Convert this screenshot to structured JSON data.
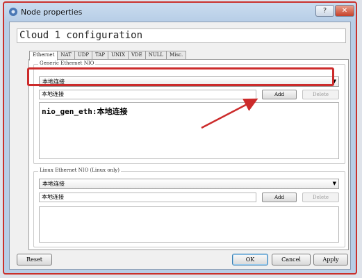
{
  "window": {
    "title": "Node properties",
    "help_label": "?",
    "close_label": "✕"
  },
  "dialog": {
    "heading": "Cloud 1 configuration"
  },
  "tabs": [
    {
      "label": "Ethernet",
      "active": true
    },
    {
      "label": "NAT"
    },
    {
      "label": "UDP"
    },
    {
      "label": "TAP"
    },
    {
      "label": "UNIX"
    },
    {
      "label": "VDE"
    },
    {
      "label": "NULL"
    },
    {
      "label": "Misc."
    }
  ],
  "generic_nio": {
    "legend": "Generic Ethernet NIO",
    "selected": "本地连接",
    "input_value": "本地连接",
    "add_label": "Add",
    "delete_label": "Delete",
    "list": [
      "nio_gen_eth:本地连接"
    ]
  },
  "linux_nio": {
    "legend": "Linux Ethernet NIO (Linux only)",
    "selected": "本地连接",
    "input_value": "本地连接",
    "add_label": "Add",
    "delete_label": "Delete"
  },
  "footer": {
    "reset_label": "Reset",
    "ok_label": "OK",
    "cancel_label": "Cancel",
    "apply_label": "Apply"
  },
  "colors": {
    "annotation": "#cc2b2b",
    "close": "#c6412a"
  },
  "icons": {
    "app": "gear-app-icon",
    "dropdown": "chevron-down-icon"
  }
}
